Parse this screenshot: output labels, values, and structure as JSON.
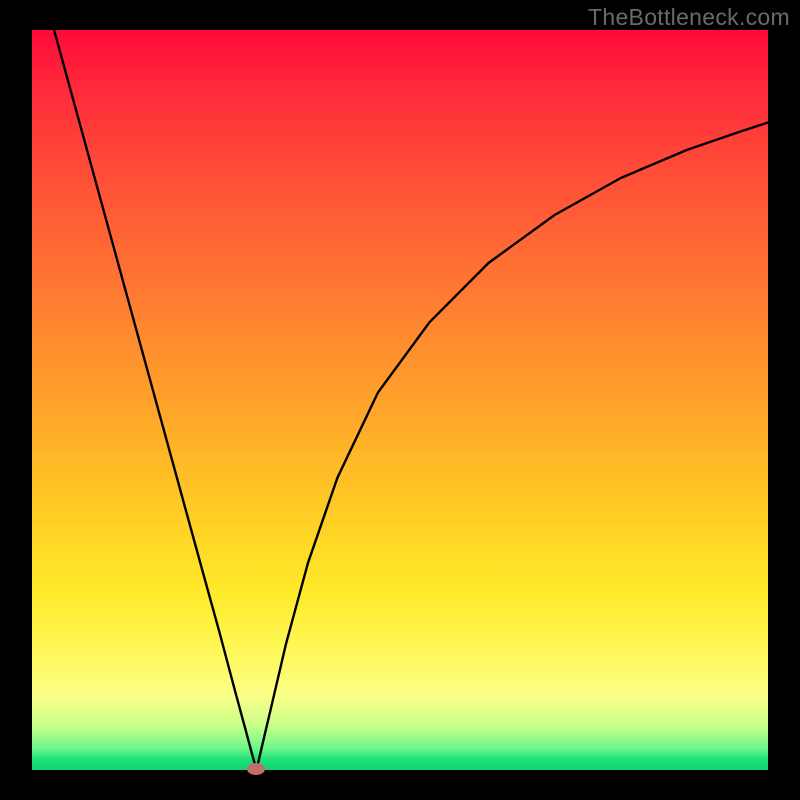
{
  "watermark": "TheBottleneck.com",
  "colors": {
    "frame": "#000000",
    "curve": "#000000",
    "marker": "#c36d6a",
    "gradient_top": "#ff0a3a",
    "gradient_bottom": "#10d574"
  },
  "marker": {
    "x_norm": 0.305,
    "y_norm": 0.0
  },
  "chart_data": {
    "type": "line",
    "title": "",
    "xlabel": "",
    "ylabel": "",
    "xlim": [
      0,
      1
    ],
    "ylim": [
      0,
      1
    ],
    "description": "Bottleneck-style V-curve: two branches descending to a minimum near x≈0.305, y≈0; left branch steep and near-linear, right branch rises with decreasing slope.",
    "series": [
      {
        "name": "left-branch",
        "x": [
          0.03,
          0.07,
          0.11,
          0.15,
          0.19,
          0.23,
          0.255,
          0.275,
          0.29,
          0.3,
          0.305
        ],
        "y": [
          1.0,
          0.855,
          0.71,
          0.565,
          0.42,
          0.275,
          0.185,
          0.11,
          0.055,
          0.018,
          0.0
        ]
      },
      {
        "name": "right-branch",
        "x": [
          0.305,
          0.312,
          0.325,
          0.345,
          0.375,
          0.415,
          0.47,
          0.54,
          0.62,
          0.71,
          0.8,
          0.89,
          0.96,
          1.0
        ],
        "y": [
          0.0,
          0.03,
          0.085,
          0.17,
          0.28,
          0.395,
          0.51,
          0.605,
          0.685,
          0.75,
          0.8,
          0.838,
          0.862,
          0.875
        ]
      }
    ],
    "minimum": {
      "x": 0.305,
      "y": 0.0
    }
  }
}
